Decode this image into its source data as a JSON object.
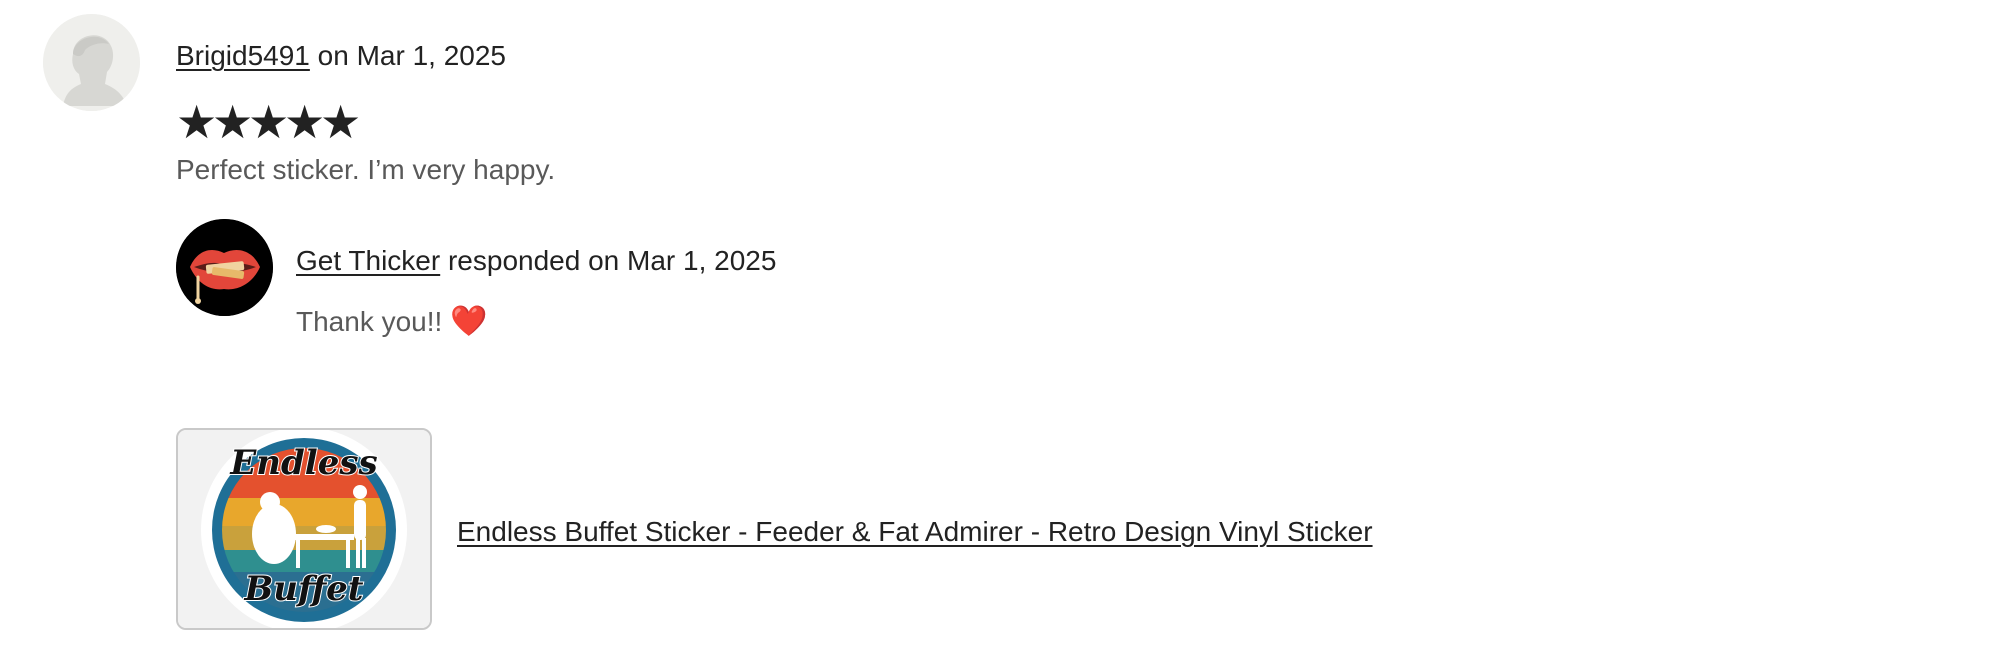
{
  "review": {
    "reviewer_name": "Brigid5491",
    "date_text": " on Mar 1, 2025",
    "rating": 5,
    "rating_max": 5,
    "stars": [
      "★",
      "★",
      "★",
      "★",
      "★"
    ],
    "text": "Perfect sticker. I’m very happy."
  },
  "response": {
    "seller_name": "Get Thicker",
    "date_text": " responded on Mar 1, 2025",
    "text": "Thank you!! ",
    "emoji": "❤️"
  },
  "listing": {
    "title": "Endless Buffet Sticker - Feeder & Fat Admirer - Retro Design Vinyl Sticker",
    "sticker_text_top": "Endless",
    "sticker_text_bottom": "Buffet"
  },
  "colors": {
    "text": "#222222",
    "muted_text": "#595959",
    "heart": "#d8232a",
    "avatar_bg": "#efefec",
    "sticker_ring": "#1f6f96"
  }
}
